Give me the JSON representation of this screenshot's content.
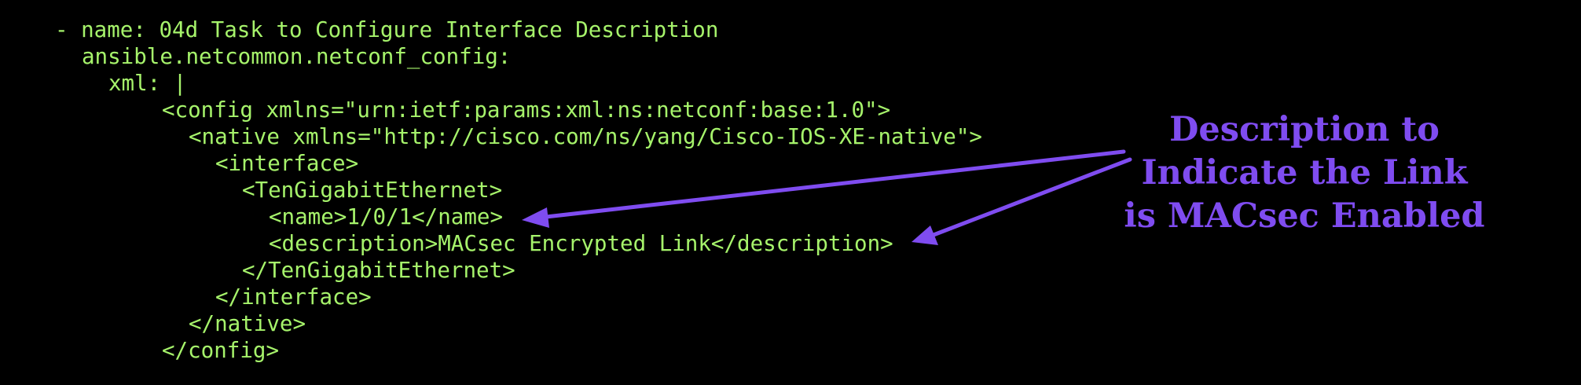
{
  "colors": {
    "background": "#000000",
    "code_text": "#a6f36b",
    "annotation": "#7f4cf0"
  },
  "code": {
    "lines": [
      "- name: 04d Task to Configure Interface Description",
      "ansible.netcommon.netconf_config:",
      "xml: |",
      "<config xmlns=\"urn:ietf:params:xml:ns:netconf:base:1.0\">",
      "<native xmlns=\"http://cisco.com/ns/yang/Cisco-IOS-XE-native\">",
      "<interface>",
      "<TenGigabitEthernet>",
      "<name>1/0/1</name>",
      "<description>MACsec Encrypted Link</description>",
      "</TenGigabitEthernet>",
      "</interface>",
      "</native>",
      "</config>"
    ]
  },
  "annotation": {
    "lines": [
      "Description to",
      "Indicate the Link",
      "is MACsec Enabled"
    ]
  }
}
